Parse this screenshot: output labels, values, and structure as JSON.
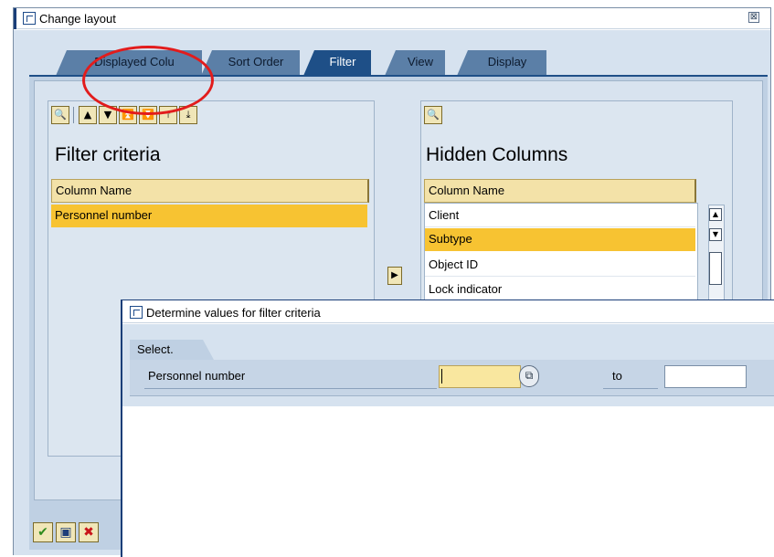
{
  "window": {
    "title": "Change layout",
    "close": "⊠"
  },
  "tabs": [
    {
      "label": "Displayed Colu",
      "active": false
    },
    {
      "label": "Sort Order",
      "active": false
    },
    {
      "label": "Filter",
      "active": true
    },
    {
      "label": "View",
      "active": false
    },
    {
      "label": "Display",
      "active": false
    }
  ],
  "left_panel": {
    "title": "Filter criteria",
    "column_header": "Column Name",
    "rows": [
      {
        "label": "Personnel number",
        "selected": true
      }
    ],
    "toolbar_icons": [
      "find-icon",
      "move-up-icon",
      "move-down-icon",
      "move-top-icon",
      "move-bottom-icon"
    ]
  },
  "right_panel": {
    "title": "Hidden Columns",
    "column_header": "Column Name",
    "rows": [
      {
        "label": "Client",
        "selected": false
      },
      {
        "label": "Subtype",
        "selected": true
      },
      {
        "label": "Object ID",
        "selected": false
      },
      {
        "label": "Lock indicator",
        "selected": false
      }
    ],
    "toolbar_icons": [
      "find-icon"
    ]
  },
  "dialog": {
    "title": "Determine values for filter criteria",
    "group_label": "Select.",
    "field_label": "Personnel number",
    "from_value": "",
    "to_label": "to",
    "to_value": ""
  },
  "footer_icons": [
    "confirm-icon",
    "save-icon",
    "cancel-icon"
  ],
  "colors": {
    "selected_row": "#f7c332",
    "active_tab": "#1e4f87",
    "annotation": "#e21c1c"
  }
}
